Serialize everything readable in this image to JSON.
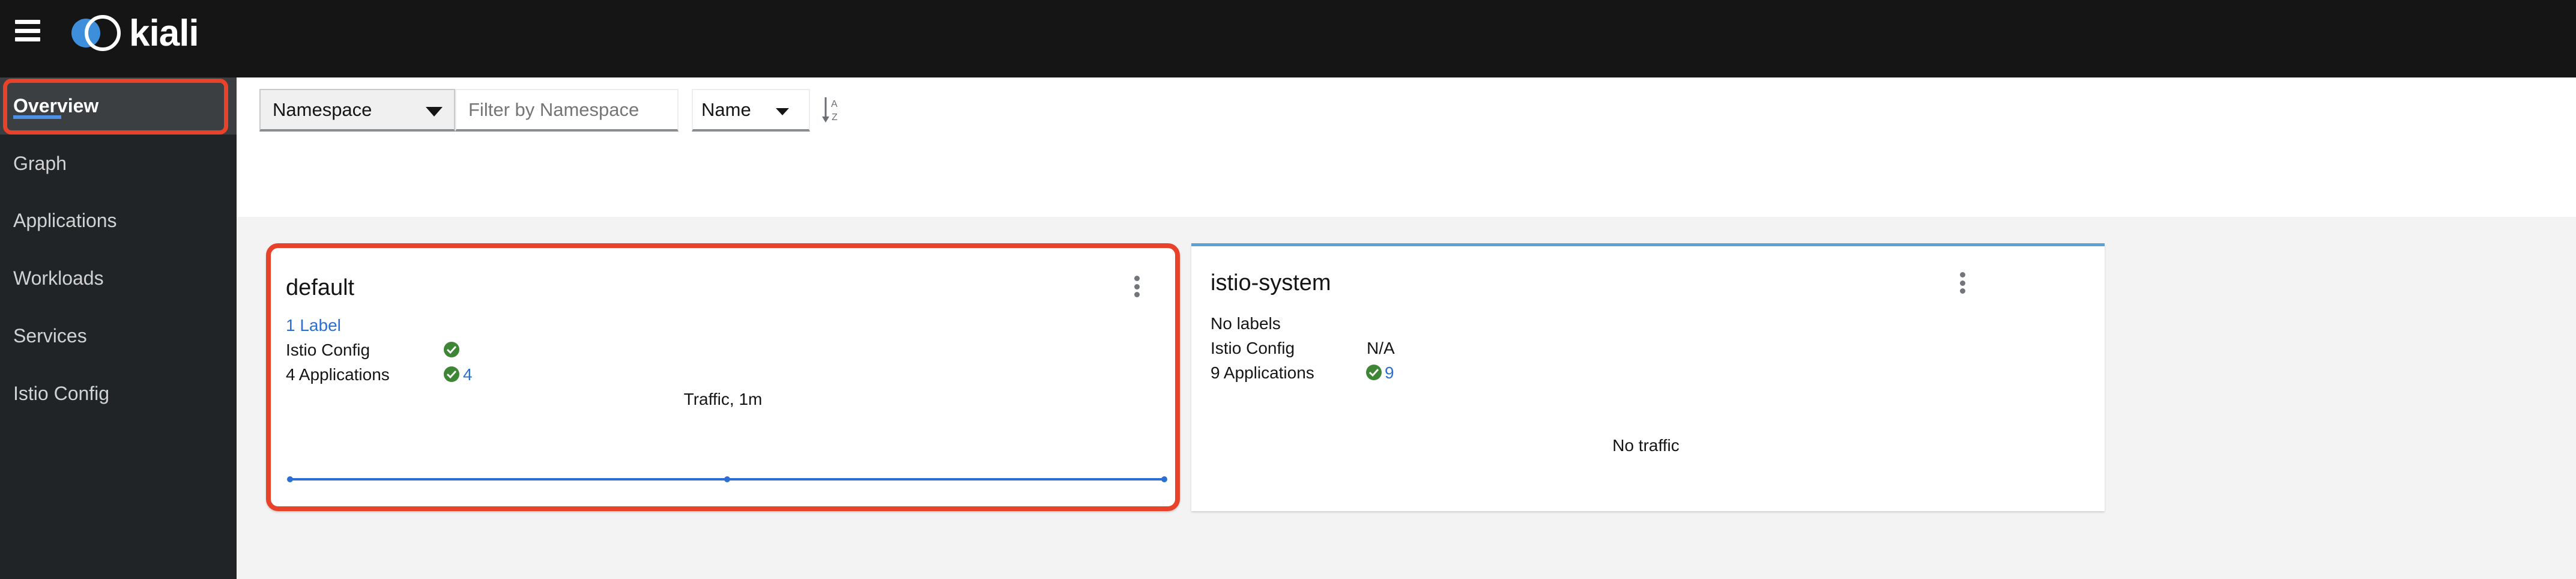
{
  "header": {
    "logo_text": "kiali",
    "menu_icon": "hamburger-icon"
  },
  "sidebar": {
    "items": [
      {
        "label": "Overview",
        "active": true
      },
      {
        "label": "Graph"
      },
      {
        "label": "Applications"
      },
      {
        "label": "Workloads"
      },
      {
        "label": "Services"
      },
      {
        "label": "Istio Config"
      }
    ]
  },
  "toolbar": {
    "filter_type": "Namespace",
    "filter_placeholder": "Filter by Namespace",
    "sort_field": "Name",
    "sort_icon": "sort-alpha-asc-icon"
  },
  "colors": {
    "accent": "#4d91e8",
    "highlight": "#e8432a",
    "healthy": "#3e8635",
    "link": "#2b6fd4"
  },
  "cards": [
    {
      "name": "default",
      "labels": "1 Label",
      "istio_config_label": "Istio Config",
      "istio_config_status": "healthy",
      "apps_label": "4 Applications",
      "apps_count": "4",
      "traffic_title": "Traffic, 1m"
    },
    {
      "name": "istio-system",
      "labels": "No labels",
      "istio_config_label": "Istio Config",
      "istio_config_value": "N/A",
      "apps_label": "9 Applications",
      "apps_count": "9",
      "traffic_text": "No traffic"
    }
  ],
  "chart_data": {
    "type": "line",
    "title": "Traffic, 1m",
    "series": [
      {
        "values": [
          0,
          0,
          0
        ]
      }
    ],
    "color": "#2b6fd4"
  }
}
